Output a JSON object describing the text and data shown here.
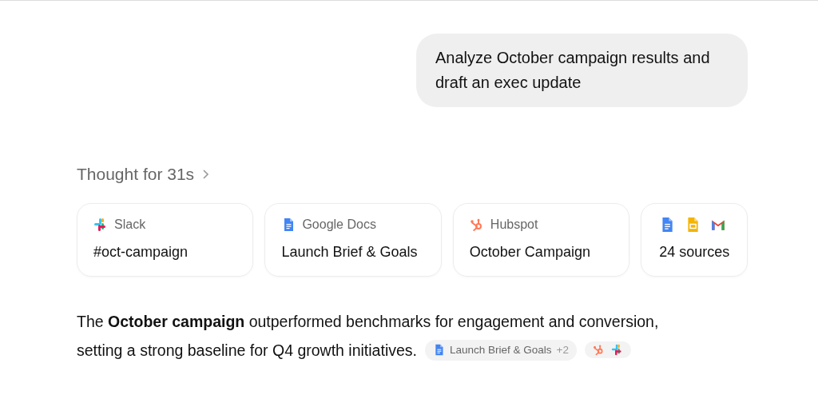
{
  "user_message": "Analyze October campaign results and draft an exec update",
  "thought": {
    "label": "Thought for 31s",
    "expanded": false
  },
  "sources": [
    {
      "kind": "slack",
      "app": "Slack",
      "title": "#oct-campaign"
    },
    {
      "kind": "gdocs",
      "app": "Google Docs",
      "title": "Launch Brief & Goals"
    },
    {
      "kind": "hubspot",
      "app": "Hubspot",
      "title": "October Campaign"
    },
    {
      "kind": "multi",
      "title": "24 sources"
    }
  ],
  "answer": {
    "lines": [
      "The **October campaign** outperformed benchmarks for engagement and conversion,",
      "setting a strong baseline for Q4 growth initiatives."
    ],
    "citations": [
      {
        "kind": "gdocs",
        "label": "Launch Brief & Goals",
        "more": "+2"
      },
      {
        "kind": "hubspot-slack"
      }
    ]
  }
}
